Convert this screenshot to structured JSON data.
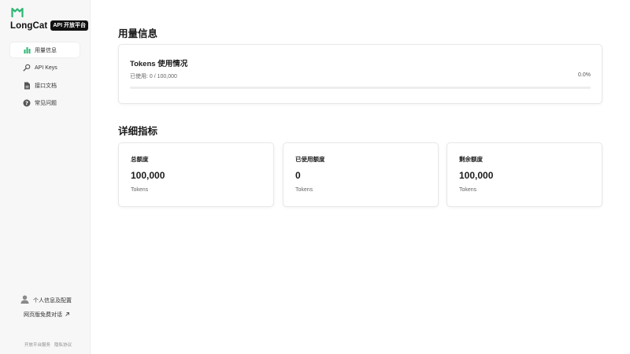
{
  "brand": {
    "name": "LongCat",
    "tag": "API 开放平台",
    "accent": "#2bb673"
  },
  "sidebar": {
    "items": [
      {
        "label": "用量信息",
        "icon": "bar-chart-icon",
        "active": true
      },
      {
        "label": "API Keys",
        "icon": "key-icon",
        "active": false
      },
      {
        "label": "接口文档",
        "icon": "document-icon",
        "active": false
      },
      {
        "label": "常见问题",
        "icon": "question-icon",
        "active": false
      }
    ],
    "profile_label": "个人信息及配置",
    "free_chat_label": "网页版免费对话",
    "free_chat_icon": "external-link-icon",
    "footer": {
      "terms": "开放平台服务",
      "privacy": "隐私协议"
    }
  },
  "usage": {
    "section_title": "用量信息",
    "card_title": "Tokens 使用情况",
    "used_label": "已使用: 0 / 100,000",
    "percent_label": "0.0%",
    "progress_fraction": 0.0
  },
  "metrics": {
    "section_title": "详细指标",
    "cards": [
      {
        "label": "总额度",
        "value": "100,000",
        "unit": "Tokens"
      },
      {
        "label": "已使用额度",
        "value": "0",
        "unit": "Tokens"
      },
      {
        "label": "剩余额度",
        "value": "100,000",
        "unit": "Tokens"
      }
    ]
  }
}
